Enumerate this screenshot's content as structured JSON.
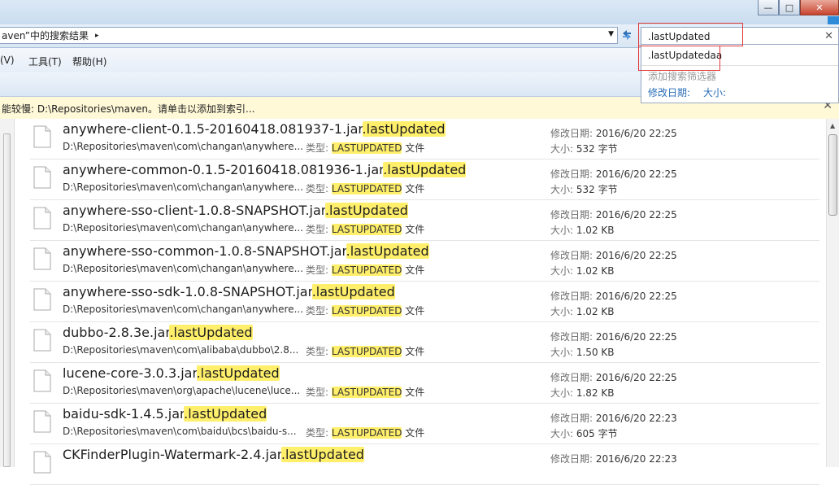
{
  "address": {
    "path": "aven”中的搜索结果",
    "arrow": "▸",
    "dropdown": "▼"
  },
  "search": {
    "query": ".lastUpdated",
    "clear": "✕"
  },
  "suggestions": {
    "item": ".lastUpdatedaa",
    "add_filter": "添加搜索筛选器",
    "filter_date": "修改日期:",
    "filter_size": "大小:"
  },
  "menu": {
    "view": "查看(V)",
    "view_visible": "(V)",
    "tools": "工具(T)",
    "help": "帮助(H)"
  },
  "infobar": {
    "text": "能较慢: D:\\Repositories\\maven。请单击以添加到索引...",
    "close": "✕"
  },
  "labels": {
    "date": "修改日期: ",
    "size": "大小: ",
    "type": "类型: ",
    "type_value": "LASTUPDATED",
    "type_suffix": " 文件"
  },
  "files": [
    {
      "name": "anywhere-client-0.1.5-20160418.081937-1.jar",
      "ext": ".lastUpdated",
      "path": "D:\\Repositories\\maven\\com\\changan\\anywhere...",
      "date": "2016/6/20 22:25",
      "size": "532 字节"
    },
    {
      "name": "anywhere-common-0.1.5-20160418.081936-1.jar",
      "ext": ".lastUpdated",
      "path": "D:\\Repositories\\maven\\com\\changan\\anywhere...",
      "date": "2016/6/20 22:25",
      "size": "532 字节"
    },
    {
      "name": "anywhere-sso-client-1.0.8-SNAPSHOT.jar",
      "ext": ".lastUpdated",
      "path": "D:\\Repositories\\maven\\com\\changan\\anywhere...",
      "date": "2016/6/20 22:25",
      "size": "1.02 KB"
    },
    {
      "name": "anywhere-sso-common-1.0.8-SNAPSHOT.jar",
      "ext": ".lastUpdated",
      "path": "D:\\Repositories\\maven\\com\\changan\\anywhere...",
      "date": "2016/6/20 22:25",
      "size": "1.02 KB"
    },
    {
      "name": "anywhere-sso-sdk-1.0.8-SNAPSHOT.jar",
      "ext": ".lastUpdated",
      "path": "D:\\Repositories\\maven\\com\\changan\\anywhere...",
      "date": "2016/6/20 22:25",
      "size": "1.02 KB"
    },
    {
      "name": "dubbo-2.8.3e.jar",
      "ext": ".lastUpdated",
      "path": "D:\\Repositories\\maven\\com\\alibaba\\dubbo\\2.8...",
      "date": "2016/6/20 22:25",
      "size": "1.50 KB"
    },
    {
      "name": "lucene-core-3.0.3.jar",
      "ext": ".lastUpdated",
      "path": "D:\\Repositories\\maven\\org\\apache\\lucene\\luce...",
      "date": "2016/6/20 22:25",
      "size": "1.82 KB"
    },
    {
      "name": "baidu-sdk-1.4.5.jar",
      "ext": ".lastUpdated",
      "path": "D:\\Repositories\\maven\\com\\baidu\\bcs\\baidu-s...",
      "date": "2016/6/20 22:23",
      "size": "605 字节"
    },
    {
      "name": "CKFinderPlugin-Watermark-2.4.jar",
      "ext": ".lastUpdated",
      "path": "",
      "date": "2016/6/20 22:23",
      "size": ""
    }
  ],
  "colors": {
    "highlight": "#ffef6b",
    "info_bar": "#fff9d8",
    "annotation_red": "#e03a3a",
    "link_blue": "#2a6db7"
  }
}
